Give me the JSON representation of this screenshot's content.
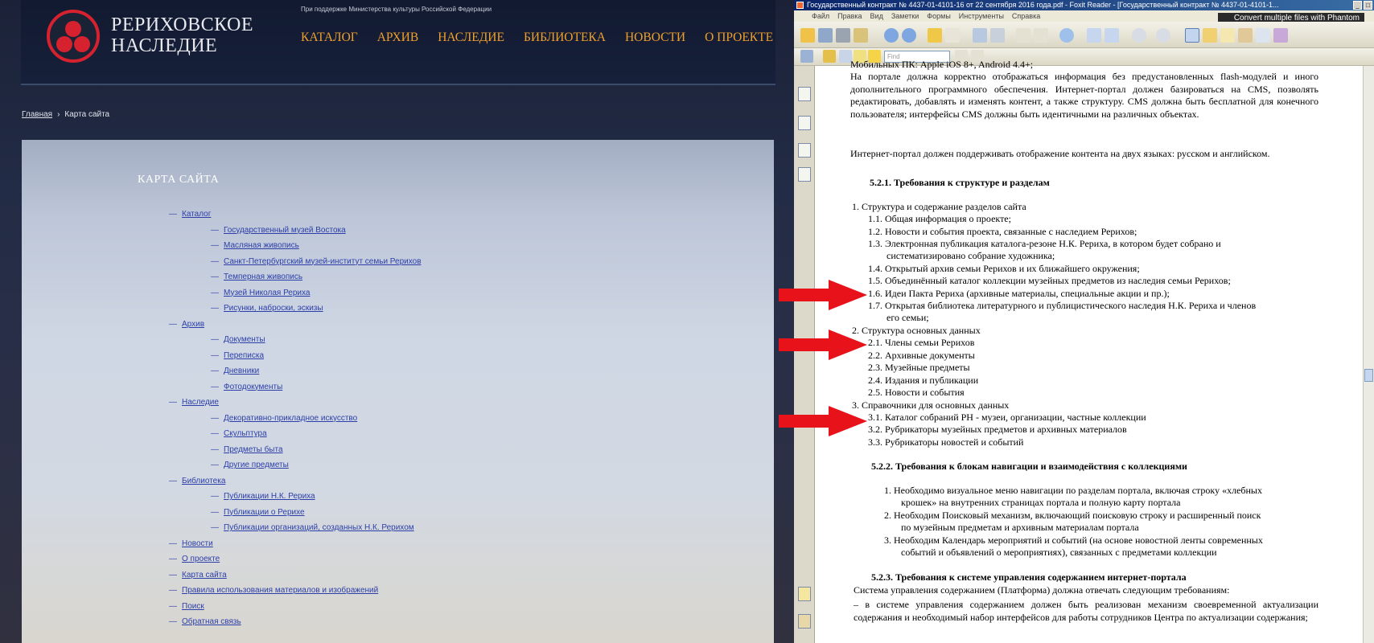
{
  "site": {
    "support_text": "При поддержке Министерства культуры Российской Федерации",
    "logo_line1": "РЕРИХОВСКОЕ",
    "logo_line2": "НАСЛЕДИЕ",
    "nav": [
      "КАТАЛОГ",
      "АРХИВ",
      "НАСЛЕДИЕ",
      "БИБЛИОТЕКА",
      "НОВОСТИ",
      "О ПРОЕКТЕ"
    ],
    "breadcrumb": {
      "home": "Главная",
      "separator": "›",
      "current": "Карта сайта"
    },
    "page_title": "КАРТА САЙТА",
    "sitemap": [
      {
        "label": "Каталог",
        "level": 0
      },
      {
        "label": "Государственный музей Востока",
        "level": 1
      },
      {
        "label": "Масляная живопись",
        "level": 1
      },
      {
        "label": "Санкт-Петербургский музей-институт семьи Рерихов",
        "level": 1
      },
      {
        "label": "Темперная живопись",
        "level": 1
      },
      {
        "label": "Музей Николая Рериха",
        "level": 1
      },
      {
        "label": "Рисунки, наброски, эскизы",
        "level": 1
      },
      {
        "label": "Архив",
        "level": 0
      },
      {
        "label": "Документы",
        "level": 1
      },
      {
        "label": "Переписка",
        "level": 1
      },
      {
        "label": "Дневники",
        "level": 1
      },
      {
        "label": "Фотодокументы",
        "level": 1
      },
      {
        "label": "Наследие",
        "level": 0
      },
      {
        "label": "Декоративно-прикладное искусство",
        "level": 1
      },
      {
        "label": "Скульптура",
        "level": 1
      },
      {
        "label": "Предметы быта",
        "level": 1
      },
      {
        "label": "Другие предметы",
        "level": 1
      },
      {
        "label": "Библиотека",
        "level": 0
      },
      {
        "label": "Публикации Н.К. Рериха",
        "level": 1
      },
      {
        "label": "Публикации о Рерихе",
        "level": 1
      },
      {
        "label": "Публикации организаций, созданных Н.К. Рерихом",
        "level": 1
      },
      {
        "label": "Новости",
        "level": 0
      },
      {
        "label": "О проекте",
        "level": 0
      },
      {
        "label": "Карта сайта",
        "level": 0
      },
      {
        "label": "Правила использования материалов и изображений",
        "level": 0
      },
      {
        "label": "Поиск",
        "level": 0
      },
      {
        "label": "Обратная связь",
        "level": 0
      }
    ],
    "colors": {
      "accent": "#f0a02c",
      "logo_red": "#d6212f",
      "link": "#2c3fa8"
    }
  },
  "reader": {
    "title": "Государственный контракт № 4437-01-4101-16 от 22 сентября 2016 года.pdf - Foxit Reader - [Государственный контракт № 4437-01-4101-1...",
    "menu": [
      "Файл",
      "Правка",
      "Вид",
      "Заметки",
      "Формы",
      "Инструменты",
      "Справка"
    ],
    "phantom_banner": "Convert multiple files with Phantom",
    "find_placeholder": "Find",
    "doc": {
      "top_cut": "Мобильных ПК: Apple iOS 8+, Android 4.4+;",
      "para1": "На портале должна корректно отображаться информация без предустановленных flash-модулей и иного дополнительного программного обеспечения. Интернет-портал должен базироваться на CMS, позволять редактировать, добавлять и изменять контент, а также структуру. CMS должна быть бесплатной для конечного пользователя; интерфейсы CMS должны быть идентичными на различных объектах.",
      "para2": "Интернет-портал должен поддерживать отображение контента на двух языках: русском и английском.",
      "h521": "5.2.1.  Требования к структуре и разделам",
      "s1": "1.   Структура и содержание разделов сайта",
      "s1_items": [
        "1.1. Общая информация о проекте;",
        "1.2. Новости и события проекта, связанные с наследием Рерихов;",
        "1.3. Электронная публикация каталога-резоне Н.К. Рериха, в котором будет собрано и",
        "систематизировано собрание художника;",
        "1.4. Открытый архив семьи Рерихов и их ближайшего окружения;",
        "1.5. Объединённый каталог коллекции музейных предметов из наследия семьи Рерихов;",
        "1.6. Идеи Пакта Рериха (архивные материалы, специальные акции и пр.);",
        "1.7. Открытая библиотека литературного и публицистического наследия Н.К. Рериха и членов",
        "его семьи;"
      ],
      "s2": "2.   Структура основных данных",
      "s2_items": [
        "2.1. Члены семьи Рерихов",
        "2.2. Архивные документы",
        "2.3. Музейные предметы",
        "2.4. Издания и публикации",
        "2.5. Новости и события"
      ],
      "s3": "3.   Справочники для основных данных",
      "s3_items": [
        "3.1. Каталог собраний РН - музеи, организации, частные коллекции",
        "3.2. Рубрикаторы музейных предметов и архивных материалов",
        "3.3. Рубрикаторы новостей и событий"
      ],
      "h522": "5.2.2.  Требования к блокам навигации и взаимодействия с коллекциями",
      "nav_reqs": [
        "1.   Необходимо визуальное меню навигации по разделам портала, включая строку «хлебных",
        "крошек» на внутренних страницах портала и полную карту портала",
        "2.   Необходим Поисковый механизм, включающий поисковую строку и расширенный поиск",
        "по музейным предметам и архивным материалам портала",
        "3.   Необходим Календарь мероприятий и событий (на основе новостной ленты современных",
        "событий и объявлений о мероприятиях), связанных с предметами коллекции"
      ],
      "h523": "5.2.3.  Требования к системе управления содержанием интернет-портала",
      "cms_intro": "Система управления содержанием (Платформа) должна отвечать следующим требованиям:",
      "cms_item": "–        в системе управления содержанием должен быть реализован механизм своевременной актуализации содержания и необходимый набор интерфейсов для работы сотрудников Центра по актуализации содержания;"
    }
  }
}
